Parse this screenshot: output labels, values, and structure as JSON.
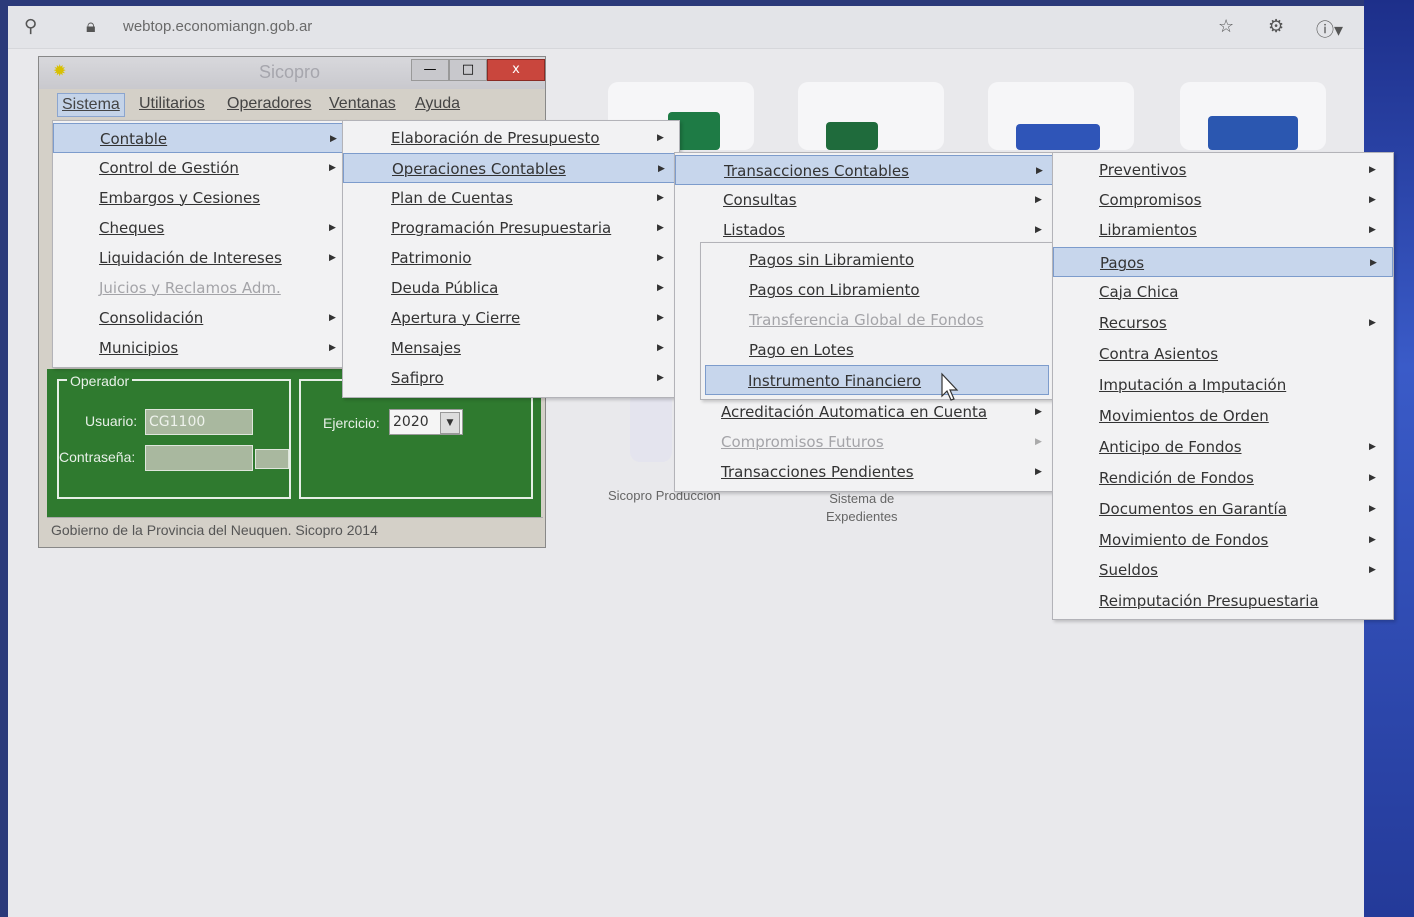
{
  "browser": {
    "url": "webtop.economiangn.gob.ar"
  },
  "tiles": {
    "label1": "Sicopro Produccion",
    "label2a": "Sistema de",
    "label2b": "Expedientes"
  },
  "window": {
    "title": "Sicopro",
    "min": "—",
    "max": "□",
    "close": "x",
    "menubar": [
      "Sistema",
      "Utilitarios",
      "Operadores",
      "Ventanas",
      "Ayuda"
    ],
    "operador_label": "Operador",
    "usuario_label": "Usuario:",
    "usuario_value": "CG1100",
    "contrasena_label": "Contraseña:",
    "ejercicio_label": "Ejercicio:",
    "ejercicio_value": "2020",
    "status": "Gobierno de la Provincia del Neuquen. Sicopro 2014"
  },
  "menu1": {
    "items": [
      "Contable",
      "Control de Gestión",
      "Embargos y Cesiones",
      "Cheques",
      "Liquidación de Intereses",
      "Juicios y Reclamos Adm.",
      "Consolidación",
      "Municipios"
    ]
  },
  "menu2": {
    "items": [
      "Elaboración de Presupuesto",
      "Operaciones Contables",
      "Plan de Cuentas",
      "Programación Presupuestaria",
      "Patrimonio",
      "Deuda Pública",
      "Apertura y Cierre",
      "Mensajes",
      "Safipro"
    ]
  },
  "menu3": {
    "items": [
      "Transacciones Contables",
      "Consultas",
      "Listados",
      "Acreditación Automatica en Cuenta",
      "Compromisos Futuros",
      "Transacciones Pendientes"
    ]
  },
  "menu4": {
    "items": [
      "Pagos sin Libramiento",
      "Pagos con Libramiento",
      "Transferencia Global de Fondos",
      "Pago en Lotes",
      "Instrumento Financiero"
    ]
  },
  "menu5": {
    "items": [
      "Preventivos",
      "Compromisos",
      "Libramientos",
      "Pagos",
      "Caja Chica",
      "Recursos",
      "Contra Asientos",
      "Imputación a Imputación",
      "Movimientos de Orden",
      "Anticipo de Fondos",
      "Rendición de Fondos",
      "Documentos en Garantía",
      "Movimiento de Fondos",
      "Sueldos",
      "Reimputación Presupuestaria"
    ]
  },
  "colors": {
    "highlight": "#c7d6ec",
    "green_panel": "#2f7a2f",
    "menu_bg": "#f2f2f3"
  }
}
